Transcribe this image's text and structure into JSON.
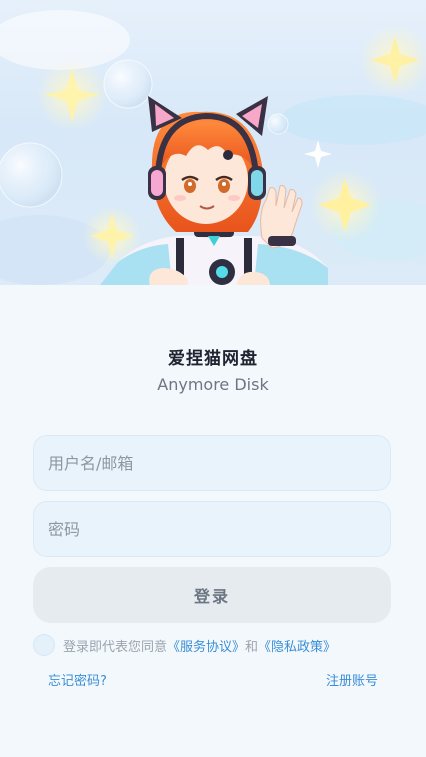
{
  "app": {
    "name": "爱捏猫网盘",
    "subtitle": "Anymore Disk"
  },
  "form": {
    "username_placeholder": "用户名/邮箱",
    "password_placeholder": "密码",
    "login_label": "登录"
  },
  "agreement": {
    "prefix": "登录即代表您同意",
    "terms_link": "《服务协议》",
    "conjunction": "和",
    "privacy_link": "《隐私政策》"
  },
  "links": {
    "forgot_password": "忘记密码?",
    "register": "注册账号"
  },
  "colors": {
    "accent": "#3a8ed6",
    "background": "#f3f8fd",
    "button_bg": "#e6ebf0"
  },
  "icons": {
    "banner": "anime-cat-girl-mascot-illustration",
    "checkbox": "agreement-checkbox"
  }
}
